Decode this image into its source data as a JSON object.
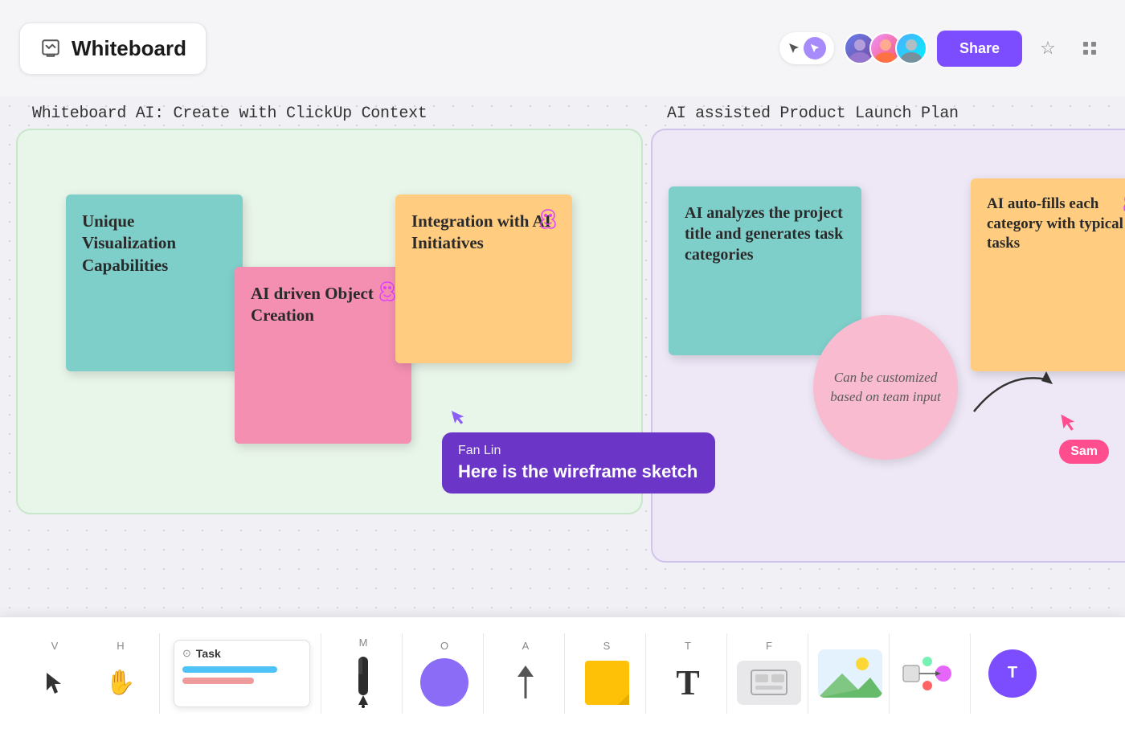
{
  "header": {
    "title": "Whiteboard",
    "share_label": "Share"
  },
  "canvas": {
    "section_left_label": "Whiteboard AI: Create with ClickUp Context",
    "section_right_label": "AI assisted Product Launch Plan",
    "sticky_teal_left": "Unique Visualization Capabilities",
    "sticky_pink_left_label": "AI driven Object Creation",
    "sticky_orange_left_label": "Integration with AI Initiatives",
    "sticky_teal_right_label": "AI analyzes the project title and generates task categories",
    "sticky_orange_right_label": "AI auto-fills each category with typical tasks",
    "circle_note_label": "Can be customized based on team input"
  },
  "tooltip": {
    "user_name": "Fan Lin",
    "message": "Here is the wireframe sketch"
  },
  "sam_label": "Sam",
  "toolbar": {
    "tools": [
      {
        "id": "select",
        "label": "V",
        "type": "cursor"
      },
      {
        "id": "hand",
        "label": "H",
        "type": "hand"
      },
      {
        "id": "task",
        "label": "",
        "type": "task"
      },
      {
        "id": "pen",
        "label": "M",
        "type": "pen"
      },
      {
        "id": "shape",
        "label": "O",
        "type": "shape"
      },
      {
        "id": "arrow",
        "label": "A",
        "type": "arrow"
      },
      {
        "id": "sticky",
        "label": "S",
        "type": "sticky"
      },
      {
        "id": "text",
        "label": "T",
        "type": "text"
      },
      {
        "id": "frame",
        "label": "F",
        "type": "frame"
      },
      {
        "id": "image",
        "label": "",
        "type": "image"
      },
      {
        "id": "flow",
        "label": "",
        "type": "flow"
      },
      {
        "id": "ai",
        "label": "",
        "type": "ai"
      }
    ]
  }
}
